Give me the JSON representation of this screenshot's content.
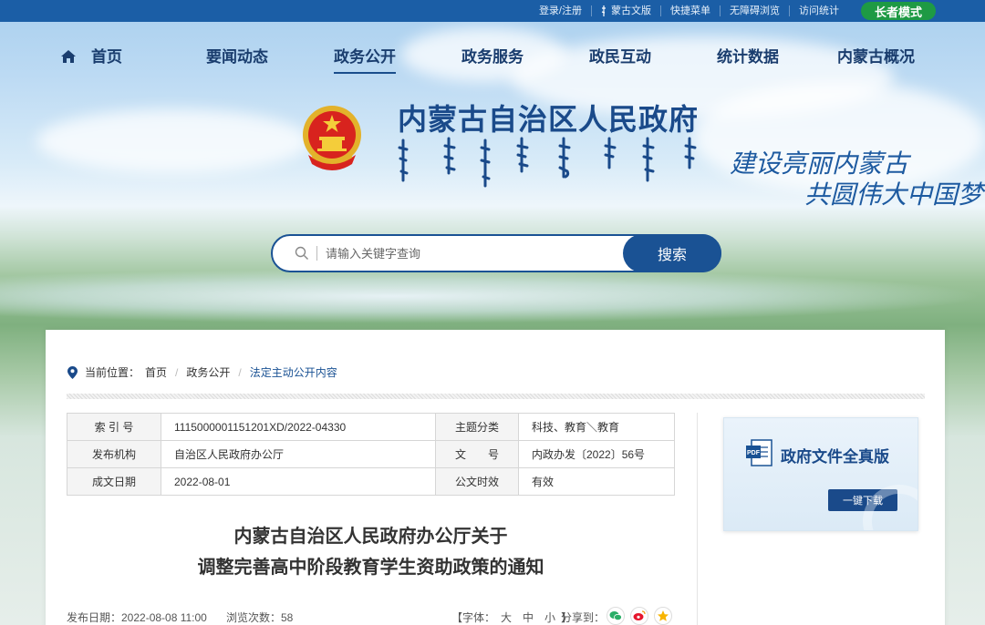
{
  "topbar": {
    "links": [
      "登录/注册",
      "蒙古文版",
      "快捷菜单",
      "无障碍浏览",
      "访问统计"
    ],
    "elder_mode": "长者模式"
  },
  "nav": {
    "items": [
      "首页",
      "要闻动态",
      "政务公开",
      "政务服务",
      "政民互动",
      "统计数据",
      "内蒙古概况"
    ],
    "active": "政务公开"
  },
  "header": {
    "site_title": "内蒙古自治区人民政府",
    "slogan_line1": "建设亮丽内蒙古",
    "slogan_line2": "共圆伟大中国梦"
  },
  "search": {
    "placeholder": "请输入关键字查询",
    "button": "搜索"
  },
  "breadcrumb": {
    "label": "当前位置：",
    "items": [
      "首页",
      "政务公开",
      "法定主动公开内容"
    ]
  },
  "meta": {
    "rows": [
      {
        "k1": "索 引 号",
        "v1": "1115000001151201XD/2022-04330",
        "k2": "主题分类",
        "v2": "科技、教育＼教育"
      },
      {
        "k1": "发布机构",
        "v1": "自治区人民政府办公厅",
        "k2": "文　　号",
        "v2": "内政办发〔2022〕56号"
      },
      {
        "k1": "成文日期",
        "v1": "2022-08-01",
        "k2": "公文时效",
        "v2": "有效"
      }
    ]
  },
  "fulltext": {
    "title": "政府文件全真版",
    "download": "一键下载"
  },
  "document": {
    "title_line1": "内蒙古自治区人民政府办公厅关于",
    "title_line2": "调整完善高中阶段教育学生资助政策的通知"
  },
  "pubbar": {
    "date": "发布日期：2022-08-08 11:00",
    "views": "浏览次数：58",
    "font_label": "【字体：",
    "font_sizes": [
      "大",
      "中",
      "小"
    ],
    "font_end": "】",
    "share": "分享到："
  },
  "colors": {
    "primary": "#1a5294",
    "topbar": "#1b5ea6",
    "elder": "#1e9a44"
  }
}
